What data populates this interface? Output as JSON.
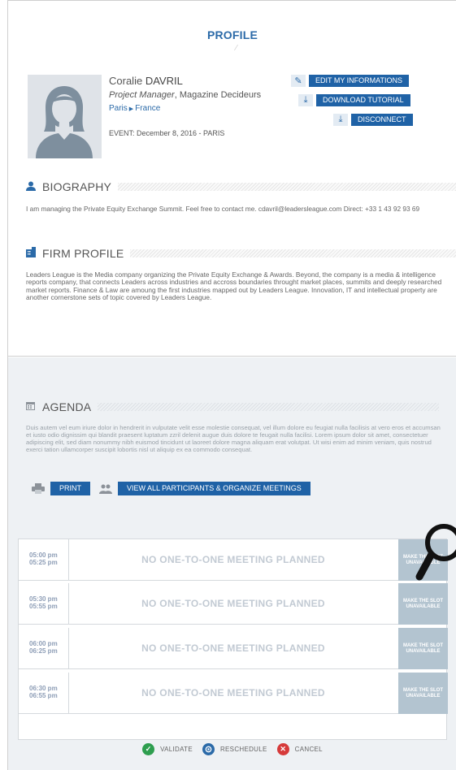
{
  "profile": {
    "title": "PROFILE",
    "first_name": "Coralie",
    "last_name": "DAVRIL",
    "position": "Project Manager",
    "company": ", Magazine Decideurs",
    "city": "Paris",
    "country": "France",
    "event": "EVENT: December 8, 2016 - PARIS",
    "buttons": {
      "edit": "EDIT MY INFORMATIONS",
      "download": "DOWNLOAD TUTORIAL",
      "disconnect": "DISCONNECT"
    }
  },
  "biography": {
    "title": "BIOGRAPHY",
    "text": "I am managing the Private Equity Exchange Summit. Feel free to contact me. cdavril@leadersleague.com Direct: +33 1 43 92 93 69"
  },
  "firm": {
    "title": "FIRM PROFILE",
    "text": "Leaders League is the Media company organizing the Private Equity Exchange & Awards. Beyond, the company is a media & intelligence reports company, that connects Leaders across industries and accross boundaries throught market places, summits and deeply researched market reports. Finance & Law are amoung the first industries mapped out by Leaders League. Innovation, IT and intellectual property are another cornerstone sets of topic covered by Leaders League."
  },
  "agenda": {
    "title": "AGENDA",
    "text": "Duis autem vel eum iriure dolor in hendrerit in vulputate velit esse molestie consequat, vel illum dolore eu feugiat nulla facilisis at vero eros et accumsan et iusto odio dignissim qui blandit praesent luptatum zzril delenit augue duis dolore te feugait nulla facilisi. Lorem ipsum dolor sit amet, consectetuer adipiscing elit, sed diam nonummy nibh euismod tincidunt ut laoreet dolore magna aliquam erat volutpat. Ut wisi enim ad minim veniam, quis nostrud exerci tation ullamcorper suscipit lobortis nisl ut aliquip ex ea commodo consequat.",
    "print_label": "PRINT",
    "view_all_label": "VIEW ALL PARTICIPANTS & ORGANIZE MEETINGS",
    "slots": [
      {
        "start": "05:00 pm",
        "end": "05:25 pm",
        "status": "NO ONE-TO-ONE MEETING PLANNED",
        "action": "MAKE THE SLOT UNAVAILABLE"
      },
      {
        "start": "05:30 pm",
        "end": "05:55 pm",
        "status": "NO ONE-TO-ONE MEETING PLANNED",
        "action": "MAKE THE SLOT UNAVAILABLE"
      },
      {
        "start": "06:00 pm",
        "end": "06:25 pm",
        "status": "NO ONE-TO-ONE MEETING PLANNED",
        "action": "MAKE THE SLOT UNAVAILABLE"
      },
      {
        "start": "06:30 pm",
        "end": "06:55 pm",
        "status": "NO ONE-TO-ONE MEETING PLANNED",
        "action": "MAKE THE SLOT UNAVAILABLE"
      }
    ],
    "legend": {
      "validate": "VALIDATE",
      "reschedule": "RESCHEDULE",
      "cancel": "CANCEL"
    }
  },
  "colors": {
    "accent": "#1f62a6",
    "validate": "#2e9e4f",
    "reschedule": "#2b6aa8",
    "cancel": "#d63a3a"
  },
  "icons": {
    "biography": "user-icon",
    "firm": "building-icon",
    "agenda": "calendar-icon",
    "edit": "pencil-icon",
    "download": "download-icon",
    "print": "printer-icon",
    "participants": "people-icon",
    "search": "magnifier-icon"
  }
}
